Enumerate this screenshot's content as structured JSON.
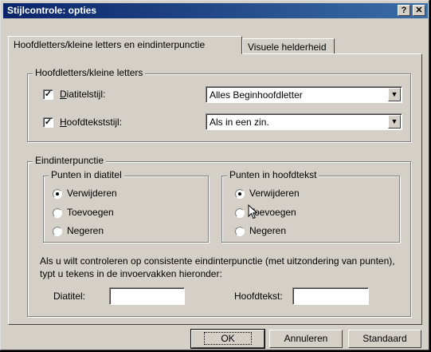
{
  "window": {
    "title": "Stijlcontrole: opties",
    "help_glyph": "?",
    "close_glyph": "✕"
  },
  "tabs": [
    {
      "label": "Hoofdletters/kleine letters en eindinterpunctie",
      "active": true
    },
    {
      "label": "Visuele helderheid",
      "active": false
    }
  ],
  "case_group": {
    "title": "Hoofdletters/kleine letters",
    "rows": [
      {
        "label": "Diatitelstijl:",
        "checked": true,
        "value": "Alles Beginhoofdletter"
      },
      {
        "label": "Hoofdtekststijl:",
        "checked": true,
        "value": "Als in een zin."
      }
    ]
  },
  "punct_group": {
    "title": "Eindinterpunctie",
    "slide_title_group": {
      "title": "Punten in diatitel",
      "options": [
        "Verwijderen",
        "Toevoegen",
        "Negeren"
      ],
      "selected": 0
    },
    "body_group": {
      "title": "Punten in hoofdtekst",
      "options": [
        "Verwijderen",
        "Toevoegen",
        "Negeren"
      ],
      "selected": 0
    },
    "instructions": "Als u wilt controleren op consistente eindinterpunctie (met uitzondering van punten), typt u tekens in de invoervakken hieronder:",
    "slide_title_label": "Diatitel:",
    "slide_title_value": "",
    "body_label": "Hoofdtekst:",
    "body_value": ""
  },
  "buttons": {
    "ok": "OK",
    "cancel": "Annuleren",
    "default": "Standaard"
  }
}
